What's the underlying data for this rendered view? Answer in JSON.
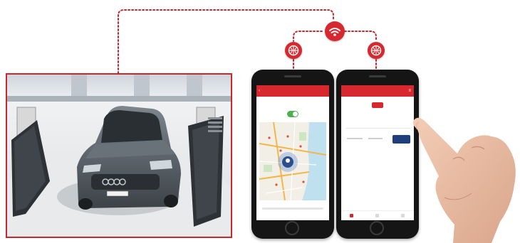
{
  "colors": {
    "accent": "#d7282f",
    "border": "#c8282d",
    "button": "#1f3f7a",
    "toggle_on": "#4caf50"
  },
  "icons": {
    "wifi": "wifi-icon",
    "network_left": "network-icon",
    "network_right": "network-icon"
  },
  "phone_left": {
    "app_title": "",
    "status": "",
    "toggle_on": true
  },
  "phone_right": {
    "app_title": "",
    "gate_label": "",
    "open_button": ""
  }
}
